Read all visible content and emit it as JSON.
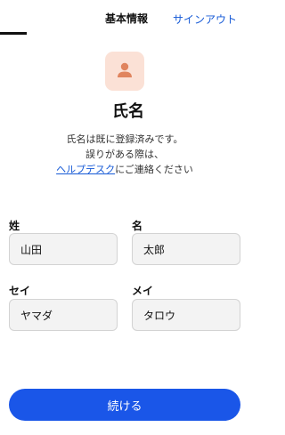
{
  "header": {
    "title": "基本情報",
    "signout_label": "サインアウト",
    "progress_fraction": 0.1
  },
  "profile": {
    "icon": "person-icon",
    "title": "氏名",
    "message_line1": "氏名は既に登録済みです。",
    "message_line2": "誤りがある際は、",
    "help_link": "ヘルプデスク",
    "message_line3_suffix": "にご連絡ください"
  },
  "form": {
    "last_name_label": "姓",
    "last_name_value": "山田",
    "first_name_label": "名",
    "first_name_value": "太郎",
    "last_kana_label": "セイ",
    "last_kana_value": "ヤマダ",
    "first_kana_label": "メイ",
    "first_kana_value": "タロウ"
  },
  "actions": {
    "continue_label": "続ける"
  },
  "colors": {
    "accent": "#1a56e8",
    "link": "#1559d6",
    "icon_bg": "#fbe1d6",
    "icon_fg": "#e0845e"
  }
}
